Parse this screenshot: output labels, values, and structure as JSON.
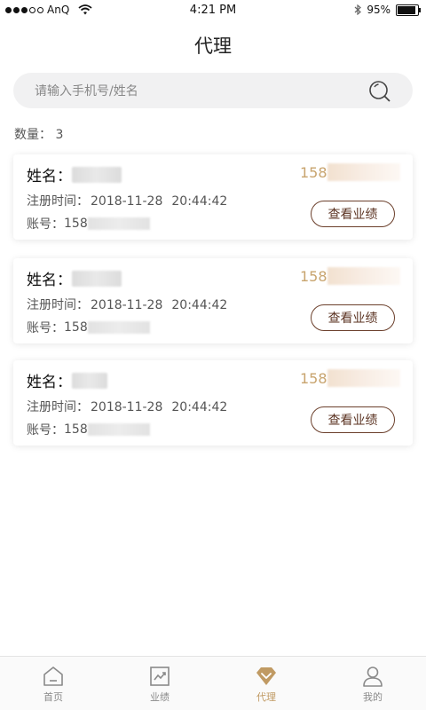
{
  "status_bar": {
    "carrier": "AnQ",
    "time": "4:21 PM",
    "battery": "95%"
  },
  "header": {
    "title": "代理"
  },
  "search": {
    "placeholder": "请输入手机号/姓名",
    "value": ""
  },
  "count": {
    "text": "数量：  3"
  },
  "card_labels": {
    "name": "姓名：",
    "register_time": "注册时间：",
    "account": "账号：",
    "view_button": "查看业绩"
  },
  "agents": [
    {
      "phone_prefix": "158",
      "register_date": "2018-11-28",
      "register_clock": "20:44:42",
      "account_prefix": "158"
    },
    {
      "phone_prefix": "158",
      "register_date": "2018-11-28",
      "register_clock": "20:44:42",
      "account_prefix": "158"
    },
    {
      "phone_prefix": "158",
      "register_date": "2018-11-28",
      "register_clock": "20:44:42",
      "account_prefix": "158"
    }
  ],
  "tabs": [
    {
      "label": "首页",
      "icon": "home-icon"
    },
    {
      "label": "业绩",
      "icon": "chart-icon"
    },
    {
      "label": "代理",
      "icon": "diamond-icon",
      "active": true
    },
    {
      "label": "我的",
      "icon": "user-icon"
    }
  ],
  "colors": {
    "accent": "#c09a63",
    "button_border": "#6b3f2b",
    "phone": "#c8a46e"
  }
}
